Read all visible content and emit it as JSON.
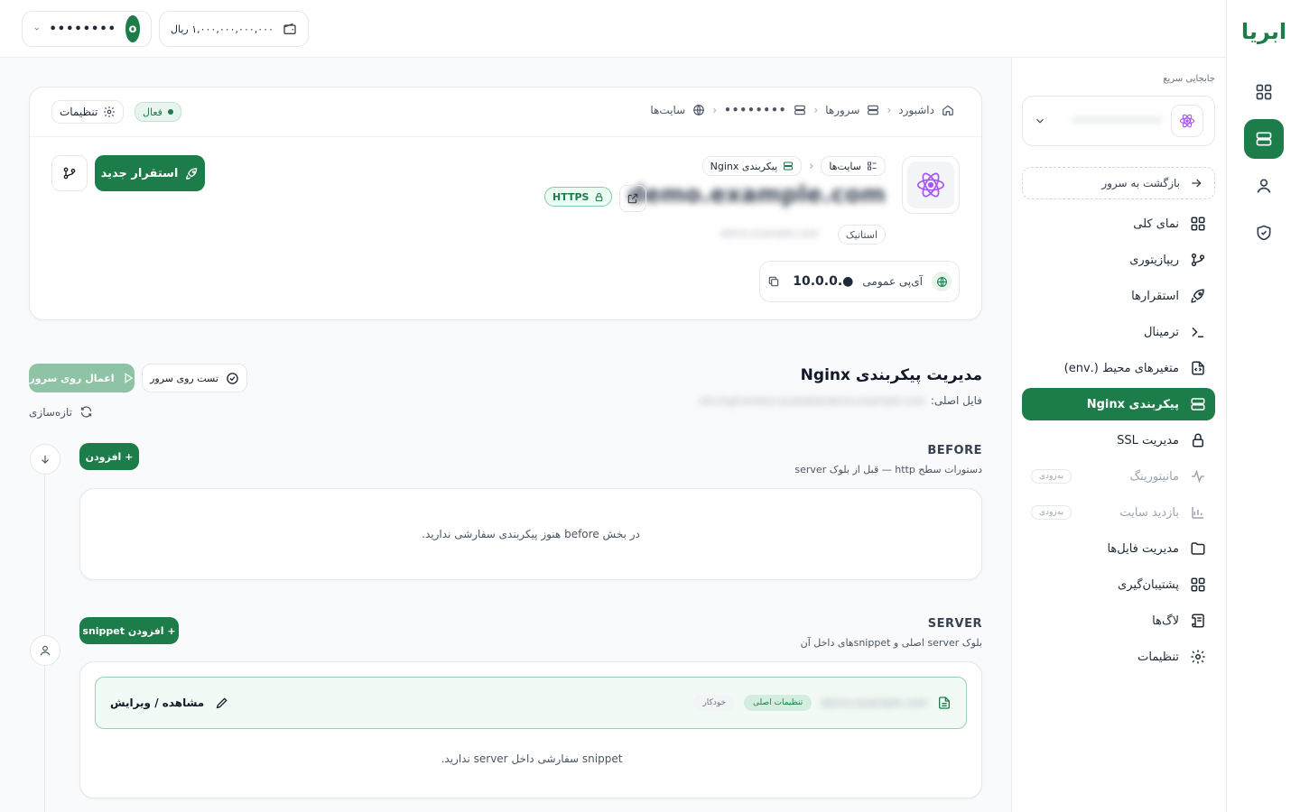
{
  "brand": {
    "logo": "ابریا",
    "accent": "#1c7c4a"
  },
  "topbar": {
    "balance": "۱,۰۰۰,۰۰۰,۰۰۰,۰۰۰ ریال",
    "user_masked": "••••••••",
    "avatar_letter": "o"
  },
  "sidebar": {
    "quick_nav_label": "جابجایی سریع",
    "quick_nav_value": "•••••••••••••",
    "back_label": "بازگشت به سرور",
    "items": [
      {
        "label": "نمای کلی",
        "icon": "grid-icon"
      },
      {
        "label": "ریپازیتوری",
        "icon": "git-branch-icon"
      },
      {
        "label": "استقرارها",
        "icon": "rocket-icon"
      },
      {
        "label": "ترمینال",
        "icon": "terminal-icon"
      },
      {
        "label": "متغیرهای محیط (.env)",
        "icon": "file-code-icon"
      },
      {
        "label": "پیکربندی Nginx",
        "icon": "server-icon"
      },
      {
        "label": "مدیریت SSL",
        "icon": "lock-icon"
      },
      {
        "label": "مانیتورینگ",
        "icon": "pulse-icon",
        "badge": "به‌زودی"
      },
      {
        "label": "بازدید سایت",
        "icon": "bar-chart-icon",
        "badge": "به‌زودی"
      },
      {
        "label": "مدیریت فایل‌ها",
        "icon": "folder-icon"
      },
      {
        "label": "پشتیبان‌گیری",
        "icon": "grid-icon"
      },
      {
        "label": "لاگ‌ها",
        "icon": "scroll-icon"
      },
      {
        "label": "تنظیمات",
        "icon": "gear-icon"
      }
    ]
  },
  "header_card": {
    "breadcrumb": [
      "داشبورد",
      "سرورها",
      "••••••••",
      "سایت‌ها"
    ],
    "status": "فعال",
    "settings_label": "تنظیمات",
    "sub_crumb": [
      "سایت‌ها",
      "پیکربندی Nginx"
    ],
    "site_name": "demo.example.com",
    "https_label": "HTTPS",
    "type_badge": "استاتیک",
    "site_sub": "demo.example.com",
    "ip_label": "آی‌پی عمومی",
    "ip_value": "10.0.0.●",
    "deploy_label": "استقرار جدید"
  },
  "nginx": {
    "title": "مدیریت پیکربندی Nginx",
    "file_label": "فایل اصلی:",
    "file_value": "/etc/nginx/sites-available/demo.example.com",
    "apply_label": "اعمال روی سرور",
    "test_label": "تست روی سرور",
    "refresh_label": "تازه‌سازی",
    "before": {
      "title": "BEFORE",
      "subtitle": "دستورات سطح http — قبل از بلوک server",
      "add_label": "+ افزودن",
      "empty": "در بخش before هنوز پیکربندی سفارشی ندارید."
    },
    "server": {
      "title": "SERVER",
      "subtitle": "بلوک server اصلی و snippetهای داخل آن",
      "add_label": "+ افزودن snippet",
      "file_name": "demo.example.com",
      "tag_main": "تنظیمات اصلی",
      "tag_auto": "خودکار",
      "edit_label": "مشاهده / ویرایش",
      "empty": "snippet سفارشی داخل server ندارید."
    }
  }
}
